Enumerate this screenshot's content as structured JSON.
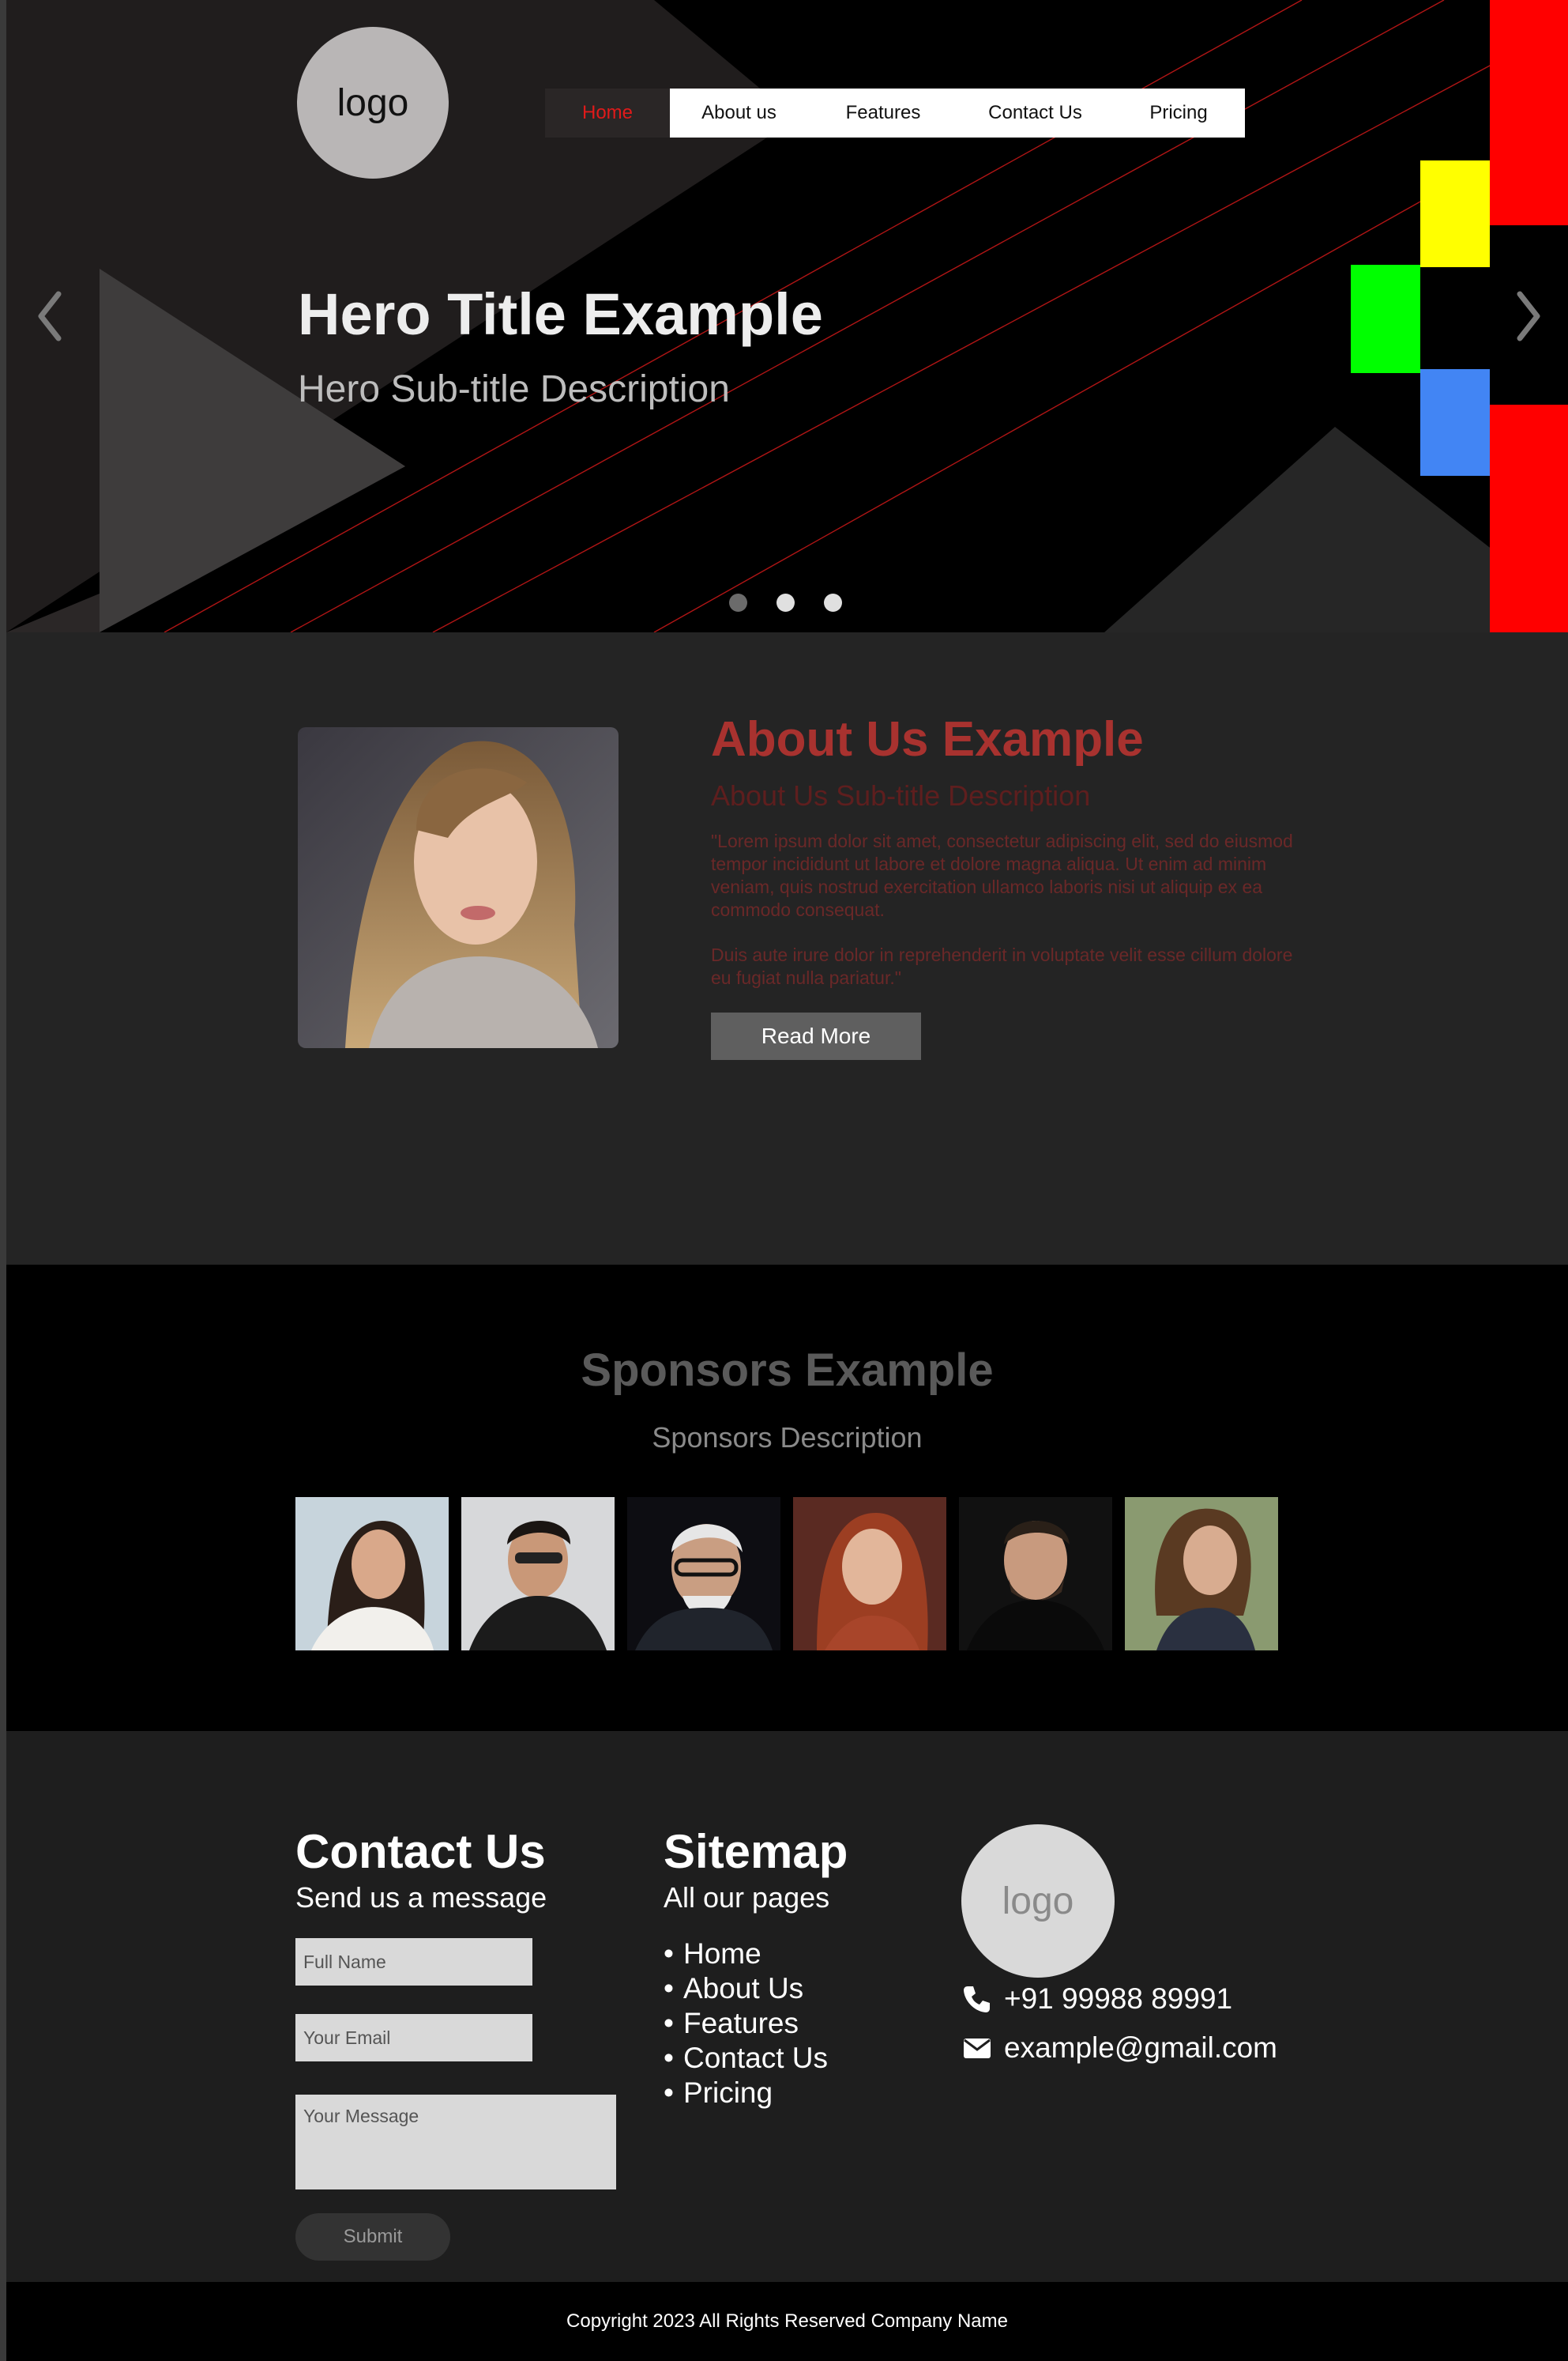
{
  "header": {
    "logo_text": "logo",
    "nav": [
      "Home",
      "About us",
      "Features",
      "Contact Us",
      "Pricing"
    ],
    "active_nav": "Home",
    "accent_color": "#e01a1a"
  },
  "hero": {
    "title": "Hero Title Example",
    "subtitle": "Hero Sub-title Description",
    "slides": 3,
    "active_slide": 2,
    "decor_colors": [
      "#ff0000",
      "#ffff00",
      "#00ff00",
      "#4285f4"
    ]
  },
  "about": {
    "title": "About Us Example",
    "subtitle": "About Us Sub-title Description",
    "paragraph1": "\"Lorem ipsum dolor sit amet, consectetur adipiscing elit, sed do eiusmod tempor incididunt ut labore et dolore magna aliqua. Ut enim ad minim veniam, quis nostrud exercitation ullamco laboris nisi ut aliquip ex ea commodo consequat.",
    "paragraph2": "Duis aute irure dolor in reprehenderit in voluptate velit esse cillum dolore eu fugiat nulla pariatur.\"",
    "button": "Read More"
  },
  "sponsors": {
    "title": "Sponsors Example",
    "description": "Sponsors Description"
  },
  "contact": {
    "title": "Contact Us",
    "subtitle": "Send us a message",
    "name_placeholder": "Full Name",
    "email_placeholder": "Your Email",
    "message_placeholder": "Your Message",
    "submit": "Submit"
  },
  "sitemap": {
    "title": "Sitemap",
    "subtitle": "All our pages",
    "items": [
      "Home",
      "About Us",
      "Features",
      "Contact Us",
      "Pricing"
    ]
  },
  "company": {
    "logo_text": "logo",
    "phone": "+91 99988 89991",
    "email": "example@gmail.com"
  },
  "copyright": "Copyright 2023 All Rights Reserved Company Name"
}
